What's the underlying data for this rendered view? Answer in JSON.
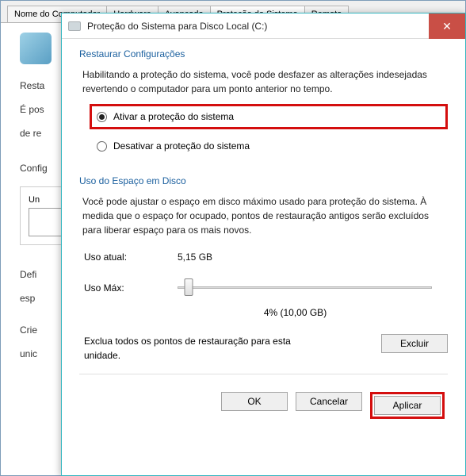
{
  "parent": {
    "tabs": [
      "Nome do Computador",
      "Hardware",
      "Avançado",
      "Proteção do Sistema",
      "Remoto"
    ],
    "stub1": "Resta",
    "stub2": "É pos",
    "stub3": "de re",
    "config_label": "Config",
    "un": "Un",
    "def1": "Defi",
    "def2": "esp",
    "crie1": "Crie",
    "crie2": "unic"
  },
  "dialog": {
    "title": "Proteção do Sistema para Disco Local (C:)",
    "restore": {
      "heading": "Restaurar Configurações",
      "desc": "Habilitando a proteção do sistema, você pode desfazer as alterações indesejadas revertendo o computador para um ponto anterior no tempo.",
      "opt_enable": "Ativar a proteção do sistema",
      "opt_disable": "Desativar a proteção do sistema"
    },
    "disk": {
      "heading": "Uso do Espaço em Disco",
      "desc": "Você pode ajustar o espaço em disco máximo usado para proteção do sistema. À medida que o espaço for ocupado, pontos de restauração antigos serão excluídos para liberar espaço para os mais novos.",
      "current_label": "Uso atual:",
      "current_value": "5,15 GB",
      "max_label": "Uso Máx:",
      "slider_percent": 4,
      "slider_caption": "4% (10,00 GB)",
      "delete_text": "Exclua todos os pontos de restauração para esta unidade.",
      "delete_btn": "Excluir"
    },
    "buttons": {
      "ok": "OK",
      "cancel": "Cancelar",
      "apply": "Aplicar"
    }
  }
}
